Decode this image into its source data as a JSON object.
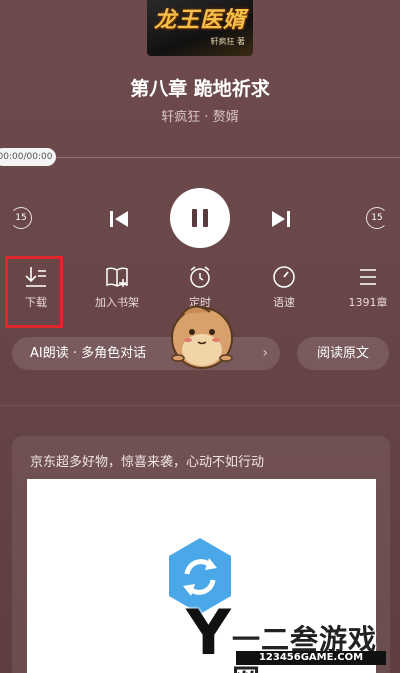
{
  "book": {
    "cover_title": "龙王医婿",
    "cover_author": "轩疯狂 著",
    "chapter_title": "第八章 跪地祈求",
    "subtitle": "轩疯狂 · 赘婿"
  },
  "player": {
    "time": "00:00/00:00",
    "progress": 0,
    "skip_back": "15",
    "skip_forward": "15"
  },
  "actions": [
    {
      "label": "下载",
      "icon": "download-icon"
    },
    {
      "label": "加入书架",
      "icon": "bookshelf-add-icon"
    },
    {
      "label": "定时",
      "icon": "alarm-clock-icon"
    },
    {
      "label": "语速",
      "icon": "speed-gauge-icon"
    },
    {
      "label": "1391章",
      "icon": "list-icon"
    }
  ],
  "ai_read": {
    "label": "AI朗读 · 多角色对话",
    "chevron": "›"
  },
  "read_original": "阅读原文",
  "ad": {
    "text": "京东超多好物，惊喜来袭，心动不如行动"
  },
  "watermark": {
    "letter": "Y",
    "brand": "一二叁游戏网",
    "url": "123456GAME.COM"
  },
  "colors": {
    "accent_highlight": "#e0262a",
    "background": "#6a4749"
  }
}
